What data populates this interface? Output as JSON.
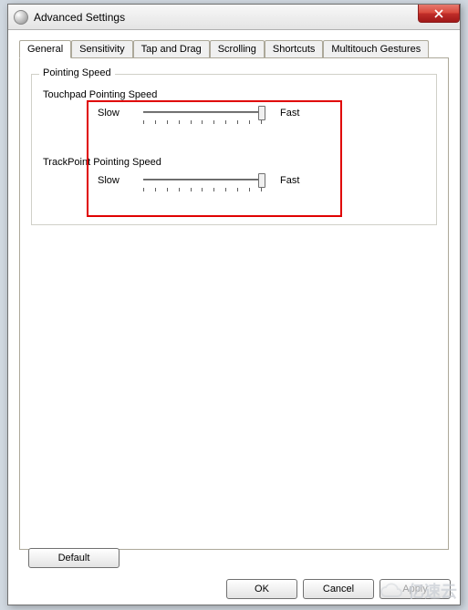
{
  "window": {
    "title": "Advanced Settings"
  },
  "tabs": [
    {
      "label": "General",
      "active": true
    },
    {
      "label": "Sensitivity"
    },
    {
      "label": "Tap and Drag"
    },
    {
      "label": "Scrolling"
    },
    {
      "label": "Shortcuts"
    },
    {
      "label": "Multitouch Gestures"
    }
  ],
  "groupbox": {
    "label": "Pointing Speed",
    "sliders": {
      "touchpad": {
        "title": "Touchpad Pointing Speed",
        "slow": "Slow",
        "fast": "Fast"
      },
      "trackpoint": {
        "title": "TrackPoint Pointing Speed",
        "slow": "Slow",
        "fast": "Fast"
      }
    }
  },
  "buttons": {
    "default": "Default",
    "ok": "OK",
    "cancel": "Cancel",
    "apply": "Apply"
  },
  "watermark": "亿速云"
}
